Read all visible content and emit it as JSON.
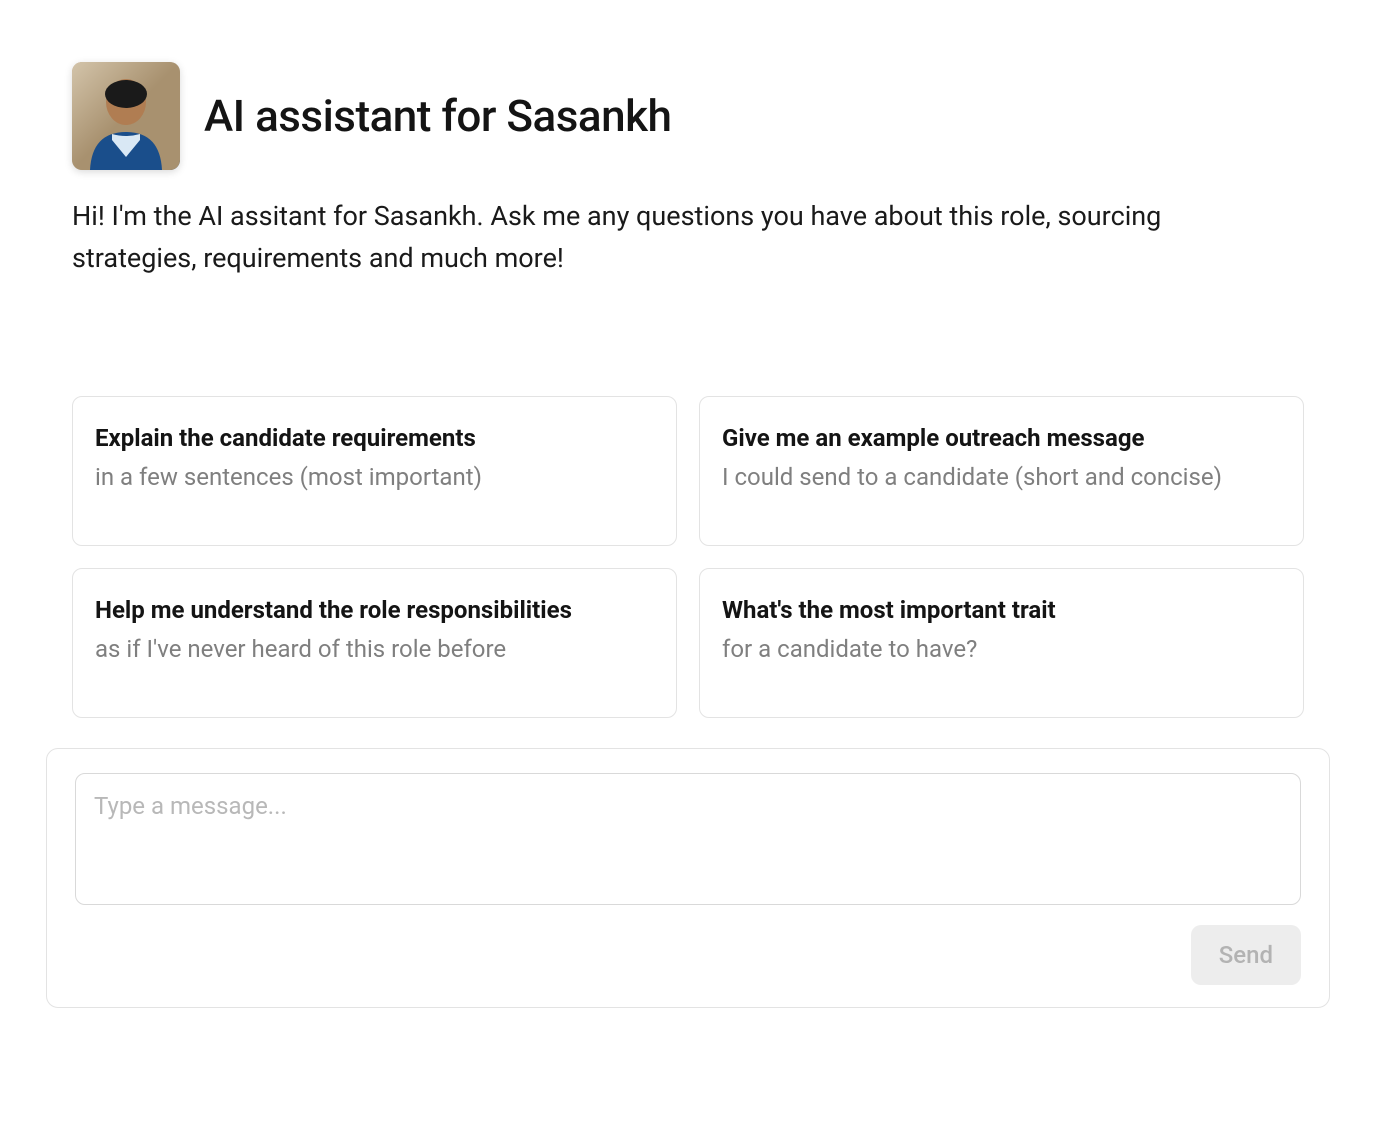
{
  "header": {
    "title": "AI assistant for Sasankh"
  },
  "intro_text": "Hi! I'm the AI assitant for Sasankh. Ask me any questions you have about this role, sourcing strategies, requirements and much more!",
  "prompts": [
    {
      "title": "Explain the candidate requirements",
      "subtitle": "in a few sentences (most important)"
    },
    {
      "title": "Give me an example outreach message",
      "subtitle": "I could send to a candidate (short and concise)"
    },
    {
      "title": "Help me understand the role responsibilities",
      "subtitle": "as if I've never heard of this role before"
    },
    {
      "title": "What's the most important trait",
      "subtitle": "for a candidate to have?"
    }
  ],
  "composer": {
    "placeholder": "Type a message...",
    "send_label": "Send"
  }
}
